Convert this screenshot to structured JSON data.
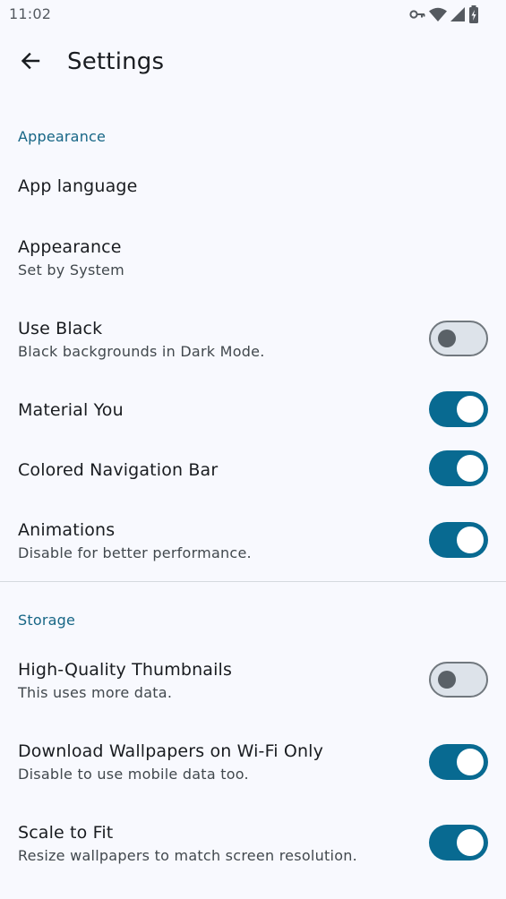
{
  "status_bar": {
    "time": "11:02",
    "icons": [
      "vpn-key-icon",
      "wifi-icon",
      "cell-signal-icon",
      "battery-charging-icon"
    ]
  },
  "app_bar": {
    "back_icon": "arrow-back-icon",
    "title": "Settings"
  },
  "sections": {
    "appearance": {
      "header": "Appearance"
    },
    "storage": {
      "header": "Storage"
    }
  },
  "items": {
    "app_language": {
      "title": "App language"
    },
    "appearance": {
      "title": "Appearance",
      "subtitle": "Set by System"
    },
    "use_black": {
      "title": "Use Black",
      "subtitle": "Black backgrounds in Dark Mode.",
      "enabled": false
    },
    "material_you": {
      "title": "Material You",
      "enabled": true
    },
    "colored_nav_bar": {
      "title": "Colored Navigation Bar",
      "enabled": true
    },
    "animations": {
      "title": "Animations",
      "subtitle": "Disable for better performance.",
      "enabled": true
    },
    "hq_thumbnails": {
      "title": "High-Quality Thumbnails",
      "subtitle": "This uses more data.",
      "enabled": false
    },
    "wifi_only": {
      "title": "Download Wallpapers on Wi-Fi Only",
      "subtitle": "Disable to use mobile data too.",
      "enabled": true
    },
    "scale_to_fit": {
      "title": "Scale to Fit",
      "subtitle": "Resize wallpapers to match screen resolution.",
      "enabled": true
    }
  },
  "colors": {
    "accent": "#086a91",
    "section_header": "#176686",
    "background": "#f8f9fe",
    "switch_off_track": "#dde3ea"
  }
}
